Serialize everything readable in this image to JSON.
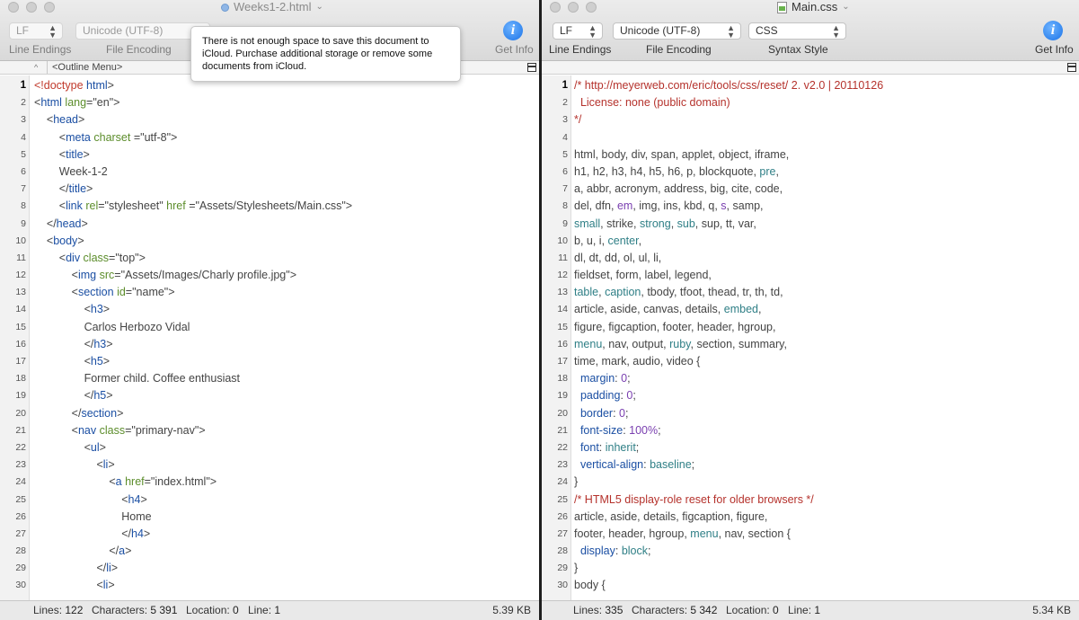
{
  "left": {
    "title": "Weeks1-2.html",
    "toolbar": {
      "line_endings_value": "LF",
      "encoding_value": "Unicode (UTF-8)",
      "line_endings_label": "Line Endings",
      "encoding_label": "File Encoding",
      "info_label": "Get Info"
    },
    "tooltip": "There is not enough space to save this document to iCloud. Purchase additional storage or remove some documents from iCloud.",
    "outline": "<Outline Menu>",
    "status": {
      "lines_label": "Lines:",
      "lines": "122",
      "chars_label": "Characters:",
      "chars": "5 391",
      "loc_label": "Location:",
      "loc": "0",
      "line_label": "Line:",
      "line": "1",
      "size": "5.39 KB"
    },
    "lines": [
      {
        "n": "1",
        "t": [
          [
            "br",
            "<!doctype "
          ],
          [
            "t",
            "html"
          ],
          [
            "s",
            ">"
          ]
        ]
      },
      {
        "n": "2",
        "t": [
          [
            "s",
            "<"
          ],
          [
            "t",
            "html"
          ],
          [
            "a",
            " lang"
          ],
          [
            "s",
            "=\"en\">"
          ]
        ]
      },
      {
        "n": "3",
        "t": [
          [
            "s",
            "    <"
          ],
          [
            "t",
            "head"
          ],
          [
            "s",
            ">"
          ]
        ]
      },
      {
        "n": "4",
        "t": [
          [
            "s",
            "        <"
          ],
          [
            "t",
            "meta"
          ],
          [
            "a",
            " charset "
          ],
          [
            "s",
            "=\"utf-8\">"
          ]
        ]
      },
      {
        "n": "5",
        "t": [
          [
            "s",
            "        <"
          ],
          [
            "t",
            "title"
          ],
          [
            "s",
            ">"
          ]
        ]
      },
      {
        "n": "6",
        "t": [
          [
            "s",
            "        Week-1-2"
          ]
        ]
      },
      {
        "n": "7",
        "t": [
          [
            "s",
            "        </"
          ],
          [
            "t",
            "title"
          ],
          [
            "s",
            ">"
          ]
        ]
      },
      {
        "n": "8",
        "t": [
          [
            "s",
            "        <"
          ],
          [
            "t",
            "link"
          ],
          [
            "a",
            " rel"
          ],
          [
            "s",
            "=\"stylesheet\" "
          ],
          [
            "a",
            "href "
          ],
          [
            "s",
            "=\"Assets/Stylesheets/Main.css\">"
          ]
        ]
      },
      {
        "n": "9",
        "t": [
          [
            "s",
            "    </"
          ],
          [
            "t",
            "head"
          ],
          [
            "s",
            ">"
          ]
        ]
      },
      {
        "n": "10",
        "t": [
          [
            "s",
            "    <"
          ],
          [
            "t",
            "body"
          ],
          [
            "s",
            ">"
          ]
        ]
      },
      {
        "n": "11",
        "t": [
          [
            "s",
            "        <"
          ],
          [
            "t",
            "div"
          ],
          [
            "a",
            " class"
          ],
          [
            "s",
            "=\"top\">"
          ]
        ]
      },
      {
        "n": "12",
        "t": [
          [
            "s",
            "            <"
          ],
          [
            "t",
            "img"
          ],
          [
            "a",
            " src"
          ],
          [
            "s",
            "=\"Assets/Images/Charly profile.jpg\">"
          ]
        ]
      },
      {
        "n": "13",
        "t": [
          [
            "s",
            "            <"
          ],
          [
            "t",
            "section"
          ],
          [
            "a",
            " id"
          ],
          [
            "s",
            "=\"name\">"
          ]
        ]
      },
      {
        "n": "14",
        "t": [
          [
            "s",
            "                <"
          ],
          [
            "t",
            "h3"
          ],
          [
            "s",
            ">"
          ]
        ]
      },
      {
        "n": "15",
        "t": [
          [
            "s",
            "                Carlos Herbozo Vidal"
          ]
        ]
      },
      {
        "n": "16",
        "t": [
          [
            "s",
            "                </"
          ],
          [
            "t",
            "h3"
          ],
          [
            "s",
            ">"
          ]
        ]
      },
      {
        "n": "17",
        "t": [
          [
            "s",
            "                <"
          ],
          [
            "t",
            "h5"
          ],
          [
            "s",
            ">"
          ]
        ]
      },
      {
        "n": "18",
        "t": [
          [
            "s",
            "                Former child. Coffee enthusiast"
          ]
        ]
      },
      {
        "n": "19",
        "t": [
          [
            "s",
            "                </"
          ],
          [
            "t",
            "h5"
          ],
          [
            "s",
            ">"
          ]
        ]
      },
      {
        "n": "20",
        "t": [
          [
            "s",
            "            </"
          ],
          [
            "t",
            "section"
          ],
          [
            "s",
            ">"
          ]
        ]
      },
      {
        "n": "21",
        "t": [
          [
            "s",
            "            <"
          ],
          [
            "t",
            "nav"
          ],
          [
            "a",
            " class"
          ],
          [
            "s",
            "=\"primary-nav\">"
          ]
        ]
      },
      {
        "n": "22",
        "t": [
          [
            "s",
            "                <"
          ],
          [
            "t",
            "ul"
          ],
          [
            "s",
            ">"
          ]
        ]
      },
      {
        "n": "23",
        "t": [
          [
            "s",
            "                    <"
          ],
          [
            "t",
            "li"
          ],
          [
            "s",
            ">"
          ]
        ]
      },
      {
        "n": "24",
        "t": [
          [
            "s",
            "                        <"
          ],
          [
            "t",
            "a"
          ],
          [
            "a",
            " href"
          ],
          [
            "s",
            "=\"index.html\">"
          ]
        ]
      },
      {
        "n": "25",
        "t": [
          [
            "s",
            "                            <"
          ],
          [
            "t",
            "h4"
          ],
          [
            "s",
            ">"
          ]
        ]
      },
      {
        "n": "26",
        "t": [
          [
            "s",
            "                            Home"
          ]
        ]
      },
      {
        "n": "27",
        "t": [
          [
            "s",
            "                            </"
          ],
          [
            "t",
            "h4"
          ],
          [
            "s",
            ">"
          ]
        ]
      },
      {
        "n": "28",
        "t": [
          [
            "s",
            "                        </"
          ],
          [
            "t",
            "a"
          ],
          [
            "s",
            ">"
          ]
        ]
      },
      {
        "n": "29",
        "t": [
          [
            "s",
            "                    </"
          ],
          [
            "t",
            "li"
          ],
          [
            "s",
            ">"
          ]
        ]
      },
      {
        "n": "30",
        "t": [
          [
            "s",
            "                    <"
          ],
          [
            "t",
            "li"
          ],
          [
            "s",
            ">"
          ]
        ]
      }
    ]
  },
  "right": {
    "title": "Main.css",
    "toolbar": {
      "line_endings_value": "LF",
      "encoding_value": "Unicode (UTF-8)",
      "syntax_value": "CSS",
      "line_endings_label": "Line Endings",
      "encoding_label": "File Encoding",
      "syntax_label": "Syntax Style",
      "info_label": "Get Info"
    },
    "status": {
      "lines_label": "Lines:",
      "lines": "335",
      "chars_label": "Characters:",
      "chars": "5 342",
      "loc_label": "Location:",
      "loc": "0",
      "line_label": "Line:",
      "line": "1",
      "size": "5.34 KB"
    },
    "lines": [
      {
        "n": "1",
        "t": [
          [
            "c",
            "/* http://meyerweb.com/eric/tools/css/reset/ 2. v2.0 | 20110126"
          ]
        ]
      },
      {
        "n": "2",
        "t": [
          [
            "c",
            "  License: none (public domain)"
          ]
        ]
      },
      {
        "n": "3",
        "t": [
          [
            "c",
            "*/"
          ]
        ]
      },
      {
        "n": "4",
        "t": []
      },
      {
        "n": "5",
        "t": [
          [
            "s",
            "html, body, div, span, applet, object, iframe,"
          ]
        ]
      },
      {
        "n": "6",
        "t": [
          [
            "s",
            "h1, h2, h3, h4, h5, h6, p, blockquote, "
          ],
          [
            "k",
            "pre"
          ],
          [
            "s",
            ","
          ]
        ]
      },
      {
        "n": "7",
        "t": [
          [
            "s",
            "a, abbr, acronym, address, big, cite, code,"
          ]
        ]
      },
      {
        "n": "8",
        "t": [
          [
            "s",
            "del, dfn, "
          ],
          [
            "v",
            "em"
          ],
          [
            "s",
            ", img, ins, kbd, q, "
          ],
          [
            "v",
            "s"
          ],
          [
            "s",
            ", samp,"
          ]
        ]
      },
      {
        "n": "9",
        "t": [
          [
            "k",
            "small"
          ],
          [
            "s",
            ", strike, "
          ],
          [
            "k",
            "strong"
          ],
          [
            "s",
            ", "
          ],
          [
            "k",
            "sub"
          ],
          [
            "s",
            ", sup, tt, var,"
          ]
        ]
      },
      {
        "n": "10",
        "t": [
          [
            "s",
            "b, u, i, "
          ],
          [
            "k",
            "center"
          ],
          [
            "s",
            ","
          ]
        ]
      },
      {
        "n": "11",
        "t": [
          [
            "s",
            "dl, dt, dd, ol, ul, li,"
          ]
        ]
      },
      {
        "n": "12",
        "t": [
          [
            "s",
            "fieldset, form, label, legend,"
          ]
        ]
      },
      {
        "n": "13",
        "t": [
          [
            "k",
            "table"
          ],
          [
            "s",
            ", "
          ],
          [
            "k",
            "caption"
          ],
          [
            "s",
            ", tbody, tfoot, thead, tr, th, td,"
          ]
        ]
      },
      {
        "n": "14",
        "t": [
          [
            "s",
            "article, aside, canvas, details, "
          ],
          [
            "k",
            "embed"
          ],
          [
            "s",
            ","
          ]
        ]
      },
      {
        "n": "15",
        "t": [
          [
            "s",
            "figure, figcaption, footer, header, hgroup,"
          ]
        ]
      },
      {
        "n": "16",
        "t": [
          [
            "k",
            "menu"
          ],
          [
            "s",
            ", nav, output, "
          ],
          [
            "k",
            "ruby"
          ],
          [
            "s",
            ", section, summary,"
          ]
        ]
      },
      {
        "n": "17",
        "t": [
          [
            "s",
            "time, mark, audio, video {"
          ]
        ]
      },
      {
        "n": "18",
        "t": [
          [
            "t",
            "  margin"
          ],
          [
            "s",
            ": "
          ],
          [
            "v",
            "0"
          ],
          [
            "s",
            ";"
          ]
        ]
      },
      {
        "n": "19",
        "t": [
          [
            "t",
            "  padding"
          ],
          [
            "s",
            ": "
          ],
          [
            "v",
            "0"
          ],
          [
            "s",
            ";"
          ]
        ]
      },
      {
        "n": "20",
        "t": [
          [
            "t",
            "  border"
          ],
          [
            "s",
            ": "
          ],
          [
            "v",
            "0"
          ],
          [
            "s",
            ";"
          ]
        ]
      },
      {
        "n": "21",
        "t": [
          [
            "t",
            "  font-size"
          ],
          [
            "s",
            ": "
          ],
          [
            "v",
            "100%"
          ],
          [
            "s",
            ";"
          ]
        ]
      },
      {
        "n": "22",
        "t": [
          [
            "t",
            "  font"
          ],
          [
            "s",
            ": "
          ],
          [
            "k",
            "inherit"
          ],
          [
            "s",
            ";"
          ]
        ]
      },
      {
        "n": "23",
        "t": [
          [
            "t",
            "  vertical-align"
          ],
          [
            "s",
            ": "
          ],
          [
            "k",
            "baseline"
          ],
          [
            "s",
            ";"
          ]
        ]
      },
      {
        "n": "24",
        "t": [
          [
            "s",
            "}"
          ]
        ]
      },
      {
        "n": "25",
        "t": [
          [
            "c",
            "/* HTML5 display-role reset for older browsers */"
          ]
        ]
      },
      {
        "n": "26",
        "t": [
          [
            "s",
            "article, aside, details, figcaption, figure,"
          ]
        ]
      },
      {
        "n": "27",
        "t": [
          [
            "s",
            "footer, header, hgroup, "
          ],
          [
            "k",
            "menu"
          ],
          [
            "s",
            ", nav, section {"
          ]
        ]
      },
      {
        "n": "28",
        "t": [
          [
            "t",
            "  display"
          ],
          [
            "s",
            ": "
          ],
          [
            "k",
            "block"
          ],
          [
            "s",
            ";"
          ]
        ]
      },
      {
        "n": "29",
        "t": [
          [
            "s",
            "}"
          ]
        ]
      },
      {
        "n": "30",
        "t": [
          [
            "s",
            "body {"
          ]
        ]
      }
    ]
  }
}
